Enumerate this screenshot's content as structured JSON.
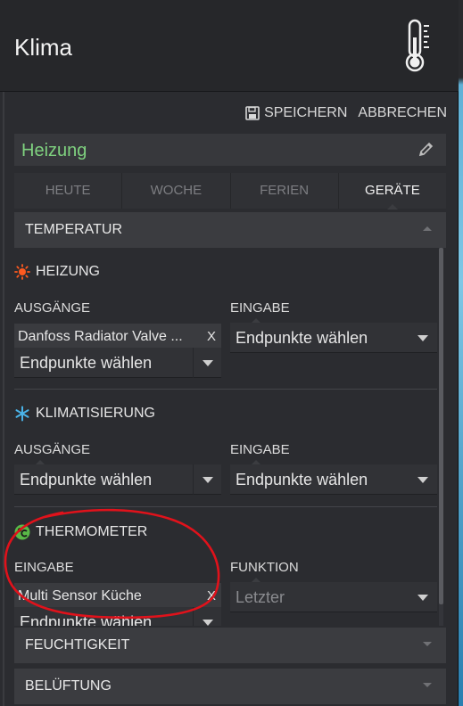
{
  "header": {
    "title": "Klima",
    "icon": "thermometer-icon"
  },
  "actions": {
    "save_label": "SPEICHERN",
    "cancel_label": "ABBRECHEN"
  },
  "name_bar": {
    "name": "Heizung",
    "name_color": "#7fd17f"
  },
  "tabs": [
    {
      "label": "HEUTE",
      "active": false
    },
    {
      "label": "WOCHE",
      "active": false
    },
    {
      "label": "FERIEN",
      "active": false
    },
    {
      "label": "GERÄTE",
      "active": true
    }
  ],
  "sections": {
    "temperatur": {
      "label": "TEMPERATUR",
      "expanded": true
    },
    "feuchtigkeit": {
      "label": "FEUCHTIGKEIT",
      "expanded": false
    },
    "belueftung": {
      "label": "BELÜFTUNG",
      "expanded": false
    }
  },
  "groups": {
    "heizung": {
      "title": "HEIZUNG",
      "icon": "sun-icon",
      "icon_color": "#ff5a1f",
      "left_label": "AUSGÄNGE",
      "right_label": "EINGABE",
      "left_chip": "Danfoss Radiator Valve ...",
      "left_chip_remove": "X",
      "left_placeholder": "Endpunkte wählen",
      "right_placeholder": "Endpunkte wählen"
    },
    "klimatisierung": {
      "title": "KLIMATISIERUNG",
      "icon": "snowflake-icon",
      "icon_color": "#4ab3e8",
      "left_label": "AUSGÄNGE",
      "right_label": "EINGABE",
      "left_placeholder": "Endpunkte wählen",
      "right_placeholder": "Endpunkte wählen"
    },
    "thermometer": {
      "title": "THERMOMETER",
      "icon": "celsius-icon",
      "icon_color": "#59b947",
      "left_label": "EINGABE",
      "right_label": "FUNKTION",
      "left_chip": "Multi Sensor Küche",
      "left_chip_remove": "X",
      "left_placeholder": "Endpunkte wählen",
      "right_value": "Letzter"
    }
  },
  "annotation": {
    "color": "#e0121b",
    "shape": "hand-drawn-ellipse"
  }
}
